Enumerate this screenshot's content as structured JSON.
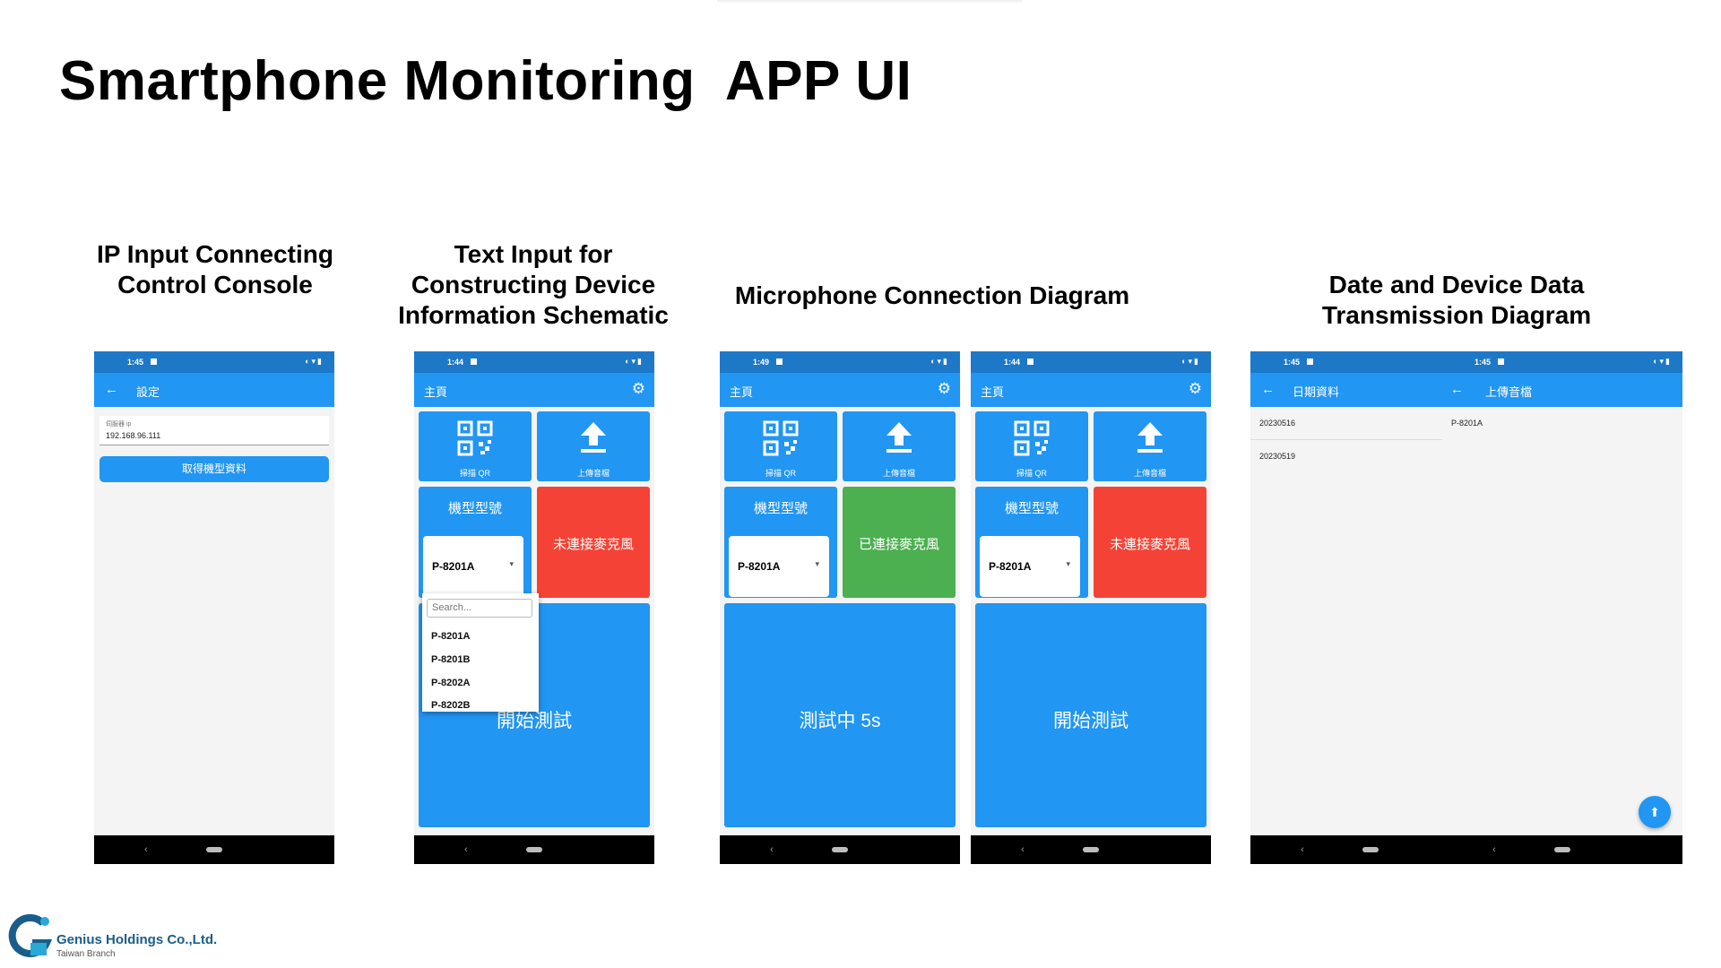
{
  "title": "Smartphone Monitoring  APP UI",
  "captions": {
    "ip": [
      "IP Input Connecting",
      "Control Console"
    ],
    "text": [
      "Text Input for",
      "Constructing Device",
      "Information Schematic"
    ],
    "mic": [
      "Microphone Connection Diagram"
    ],
    "date": [
      "Date and Device Data",
      "Transmission Diagram"
    ]
  },
  "phones": {
    "settings": {
      "time": "1:45",
      "appbar_title": "設定",
      "field_label": "伺服器 ip",
      "field_value": "192.168.96.111",
      "button_label": "取得機型資料"
    },
    "main_dropdown": {
      "time": "1:44",
      "appbar_title": "主頁",
      "scan_label": "掃描 QR",
      "upload_label": "上傳音檔",
      "model_label": "機型型號",
      "model_value": "P-8201A",
      "mic_status": "未連接麥克風",
      "start_label": "開始測試",
      "search_placeholder": "Search...",
      "options": [
        "P-8201A",
        "P-8201B",
        "P-8202A",
        "P-8202B"
      ]
    },
    "main_connected": {
      "time": "1:49",
      "appbar_title": "主頁",
      "scan_label": "掃描 QR",
      "upload_label": "上傳音檔",
      "model_label": "機型型號",
      "model_value": "P-8201A",
      "mic_status": "已連接麥克風",
      "start_label": "測試中 5s"
    },
    "main_idle": {
      "time": "1:44",
      "appbar_title": "主頁",
      "scan_label": "掃描 QR",
      "upload_label": "上傳音檔",
      "model_label": "機型型號",
      "model_value": "P-8201A",
      "mic_status": "未連接麥克風",
      "start_label": "開始測試"
    },
    "dates": {
      "time_left": "1:45",
      "time_right": "1:45",
      "title_left": "日期資料",
      "title_right": "上傳音檔",
      "dates": [
        "20230516",
        "20230519"
      ],
      "files": [
        "P-8201A"
      ]
    }
  },
  "logo": {
    "name": "Genius Holdings Co.,Ltd.",
    "sub": "Taiwan Branch"
  },
  "colors": {
    "primary": "#2196f3",
    "statusbar": "#1e78c8",
    "red": "#f44336",
    "green": "#4caf50"
  }
}
